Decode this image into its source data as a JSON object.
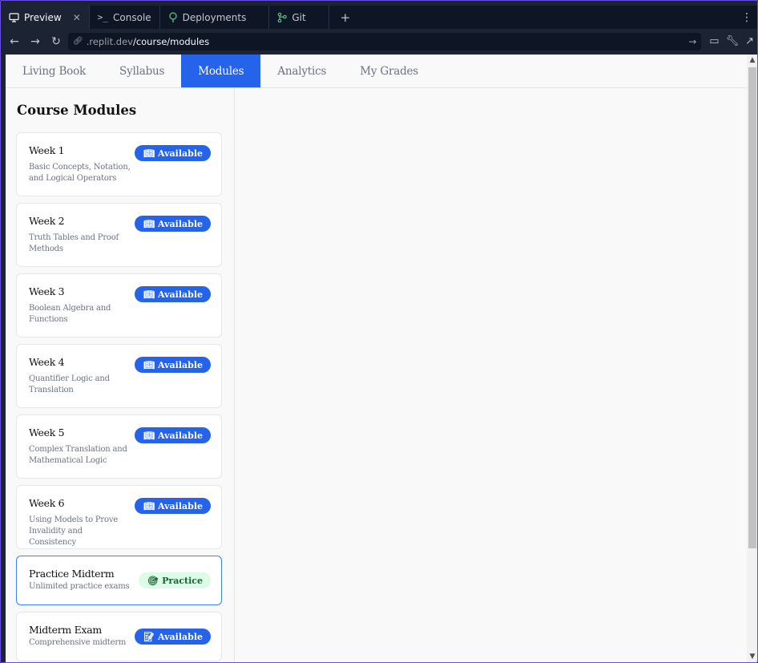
{
  "browser": {
    "tabs": [
      {
        "label": "Preview",
        "icon": "monitor-icon",
        "active": true
      },
      {
        "label": "Console",
        "icon": "terminal-icon"
      },
      {
        "label": "Deployments",
        "icon": "deploy-tree-icon"
      },
      {
        "label": "Git",
        "icon": "git-branch-icon"
      }
    ],
    "new_tab": "+",
    "more": "⋮",
    "url_prefix": ".replit.dev",
    "url_path": "/course/modules"
  },
  "nav": {
    "items": [
      "Living Book",
      "Syllabus",
      "Modules",
      "Analytics",
      "My Grades"
    ],
    "active": "Modules"
  },
  "sidebar": {
    "title": "Course Modules",
    "modules": [
      {
        "title": "Week 1",
        "desc": "Basic Concepts, Notation, and Logical Operators",
        "badge": "Available",
        "badge_icon": "book-icon"
      },
      {
        "title": "Week 2",
        "desc": "Truth Tables and Proof Methods",
        "badge": "Available",
        "badge_icon": "book-icon"
      },
      {
        "title": "Week 3",
        "desc": "Boolean Algebra and Functions",
        "badge": "Available",
        "badge_icon": "book-icon"
      },
      {
        "title": "Week 4",
        "desc": "Quantifier Logic and Translation",
        "badge": "Available",
        "badge_icon": "book-icon"
      },
      {
        "title": "Week 5",
        "desc": "Complex Translation and Mathematical Logic",
        "badge": "Available",
        "badge_icon": "book-icon"
      },
      {
        "title": "Week 6",
        "desc": "Using Models to Prove Invalidity and Consistency",
        "badge": "Available",
        "badge_icon": "book-icon"
      },
      {
        "title": "Practice Midterm",
        "desc": "Unlimited practice exams",
        "badge": "Practice",
        "badge_icon": "target-icon"
      },
      {
        "title": "Midterm Exam",
        "desc": "Comprehensive midterm",
        "badge": "Available",
        "badge_icon": "memo-icon"
      }
    ]
  },
  "colors": {
    "accent": "#2563eb",
    "practice_bg": "#dcfce7",
    "practice_text": "#166534",
    "chrome_bg": "#1c2333",
    "frame_border": "#6a4be0"
  }
}
